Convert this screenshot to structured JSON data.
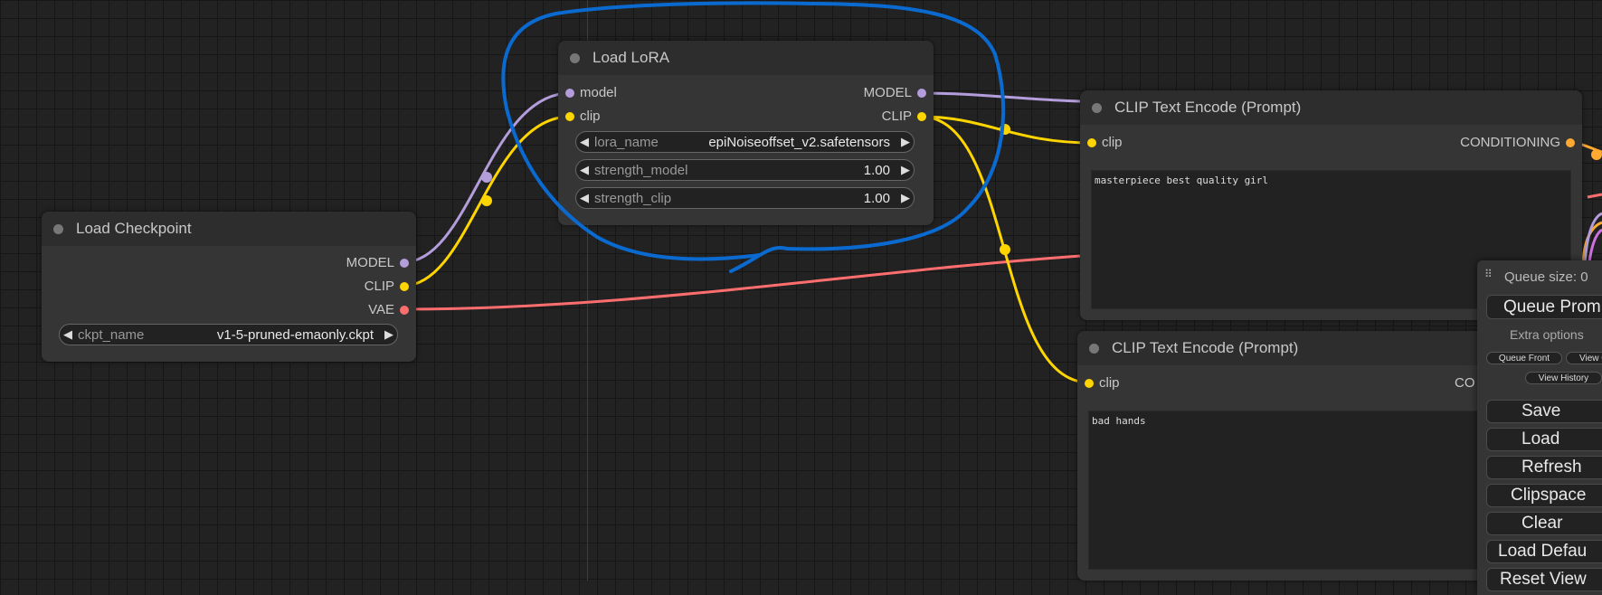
{
  "colors": {
    "model": "#b39ddb",
    "clip": "#ffd500",
    "vae": "#ff6e6e",
    "conditioning": "#ffa931",
    "annotation": "#0a6ad0"
  },
  "checkpoint_node": {
    "title": "Load Checkpoint",
    "outputs": [
      "MODEL",
      "CLIP",
      "VAE"
    ],
    "widget": {
      "name": "ckpt_name",
      "value": "v1-5-pruned-emaonly.ckpt"
    }
  },
  "lora_node": {
    "title": "Load LoRA",
    "inputs": [
      "model",
      "clip"
    ],
    "outputs": [
      "MODEL",
      "CLIP"
    ],
    "widgets": [
      {
        "name": "lora_name",
        "value": "epiNoiseoffset_v2.safetensors"
      },
      {
        "name": "strength_model",
        "value": "1.00"
      },
      {
        "name": "strength_clip",
        "value": "1.00"
      }
    ]
  },
  "clip_pos_node": {
    "title": "CLIP Text Encode (Prompt)",
    "input": "clip",
    "output": "CONDITIONING",
    "text": "masterpiece best quality girl"
  },
  "clip_neg_node": {
    "title": "CLIP Text Encode (Prompt)",
    "input": "clip",
    "output": "CO",
    "text": "bad hands"
  },
  "queue_menu": {
    "queue_size": "Queue size: 0",
    "queue_prompt": "Queue Prom",
    "extra_options": "Extra options",
    "queue_front": "Queue Front",
    "view_queue": "View Q",
    "view_history": "View History",
    "buttons": [
      "Save",
      "Load",
      "Refresh",
      "Clipspace",
      "Clear",
      "Load Defau",
      "Reset View"
    ]
  }
}
